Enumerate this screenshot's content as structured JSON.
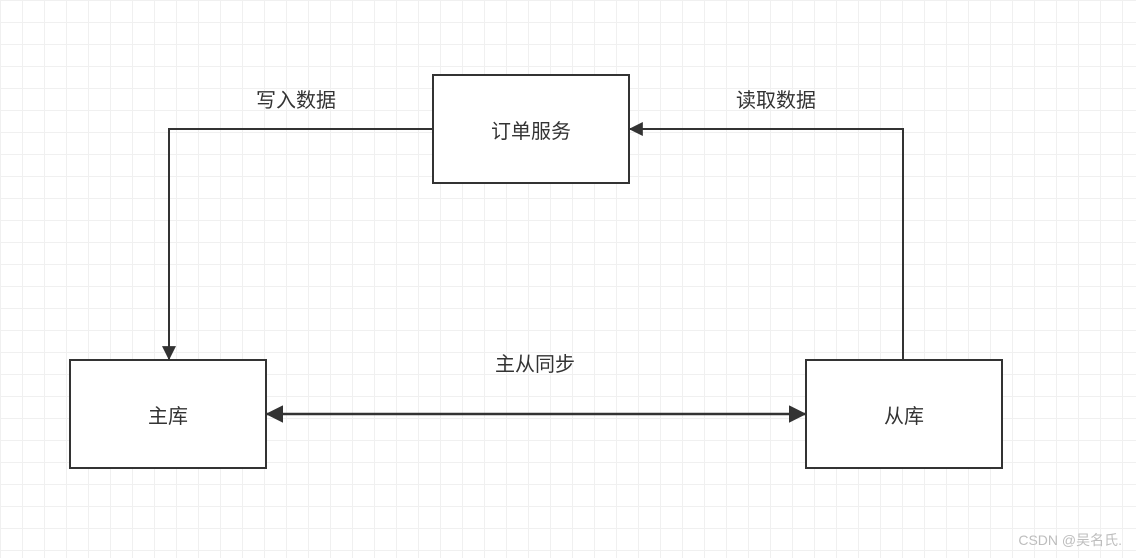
{
  "nodes": {
    "order_service": {
      "label": "订单服务"
    },
    "master_db": {
      "label": "主库"
    },
    "slave_db": {
      "label": "从库"
    }
  },
  "edges": {
    "write": {
      "label": "写入数据"
    },
    "read": {
      "label": "读取数据"
    },
    "sync": {
      "label": "主从同步"
    }
  },
  "watermark": "CSDN @吴名氏."
}
